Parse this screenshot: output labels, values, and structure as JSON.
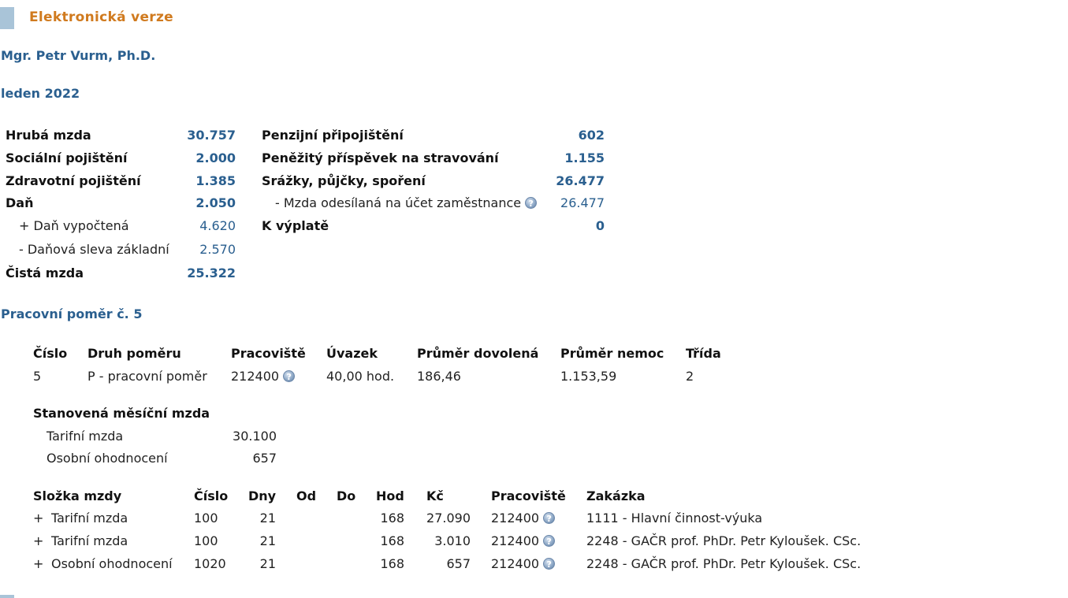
{
  "header": {
    "title": "Elektronická verze"
  },
  "employee": {
    "name": "Mgr. Petr Vurm, Ph.D."
  },
  "period": {
    "label": "leden 2022"
  },
  "summary_left": [
    {
      "label": "Hrubá mzda",
      "value": "30.757",
      "kind": "main"
    },
    {
      "label": "Sociální pojištění",
      "value": "2.000",
      "kind": "main"
    },
    {
      "label": "Zdravotní pojištění",
      "value": "1.385",
      "kind": "main"
    },
    {
      "label": "Daň",
      "value": "2.050",
      "kind": "main"
    },
    {
      "label": "+ Daň vypočtená",
      "value": "4.620",
      "kind": "sub"
    },
    {
      "label": "- Daňová sleva základní",
      "value": "2.570",
      "kind": "sub"
    },
    {
      "label": "Čistá mzda",
      "value": "25.322",
      "kind": "main"
    }
  ],
  "summary_right": [
    {
      "label": "Penzijní připojištění",
      "value": "602",
      "kind": "main"
    },
    {
      "label": "Peněžitý příspěvek na stravování",
      "value": "1.155",
      "kind": "main"
    },
    {
      "label": "Srážky, půjčky, spoření",
      "value": "26.477",
      "kind": "main"
    },
    {
      "label": "- Mzda odesílaná na účet zaměstnance",
      "value": "26.477",
      "kind": "sub"
    },
    {
      "label": "K výplatě",
      "value": "0",
      "kind": "main"
    }
  ],
  "contract": {
    "title": "Pracovní poměr č. 5",
    "headers": [
      "Číslo",
      "Druh poměru",
      "Pracoviště",
      "Úvazek",
      "Průměr dovolená",
      "Průměr nemoc",
      "Třída"
    ],
    "row": [
      "5",
      "P - pracovní poměr",
      "212400",
      "40,00 hod.",
      "186,46",
      "1.153,59",
      "2"
    ]
  },
  "monthly": {
    "title": "Stanovená měsíční mzda",
    "rows": [
      {
        "label": "Tarifní mzda",
        "value": "30.100"
      },
      {
        "label": "Osobní ohodnocení",
        "value": "657"
      }
    ]
  },
  "components": {
    "headers": [
      "Složka mzdy",
      "Číslo",
      "Dny",
      "Od",
      "Do",
      "Hod",
      "Kč",
      "Pracoviště",
      "Zakázka"
    ],
    "rows": [
      {
        "sign": "+",
        "name": "Tarifní mzda",
        "cislo": "100",
        "dny": "21",
        "od": "",
        "do": "",
        "hod": "168",
        "kc": "27.090",
        "pracoviste": "212400",
        "zakazka": "1111 - Hlavní činnost-výuka"
      },
      {
        "sign": "+",
        "name": "Tarifní mzda",
        "cislo": "100",
        "dny": "21",
        "od": "",
        "do": "",
        "hod": "168",
        "kc": "3.010",
        "pracoviste": "212400",
        "zakazka": "2248 - GAČR prof. PhDr. Petr Kyloušek. CSc."
      },
      {
        "sign": "+",
        "name": "Osobní ohodnocení",
        "cislo": "1020",
        "dny": "21",
        "od": "",
        "do": "",
        "hod": "168",
        "kc": "657",
        "pracoviste": "212400",
        "zakazka": "2248 - GAČR prof. PhDr. Petr Kyloušek. CSc."
      }
    ]
  },
  "icons": {
    "info": "info-icon",
    "info_glyph": "?"
  },
  "colors": {
    "accent_orange": "#d07a1e",
    "accent_blue": "#2a5f8f",
    "bar": "#a9c4d8"
  }
}
